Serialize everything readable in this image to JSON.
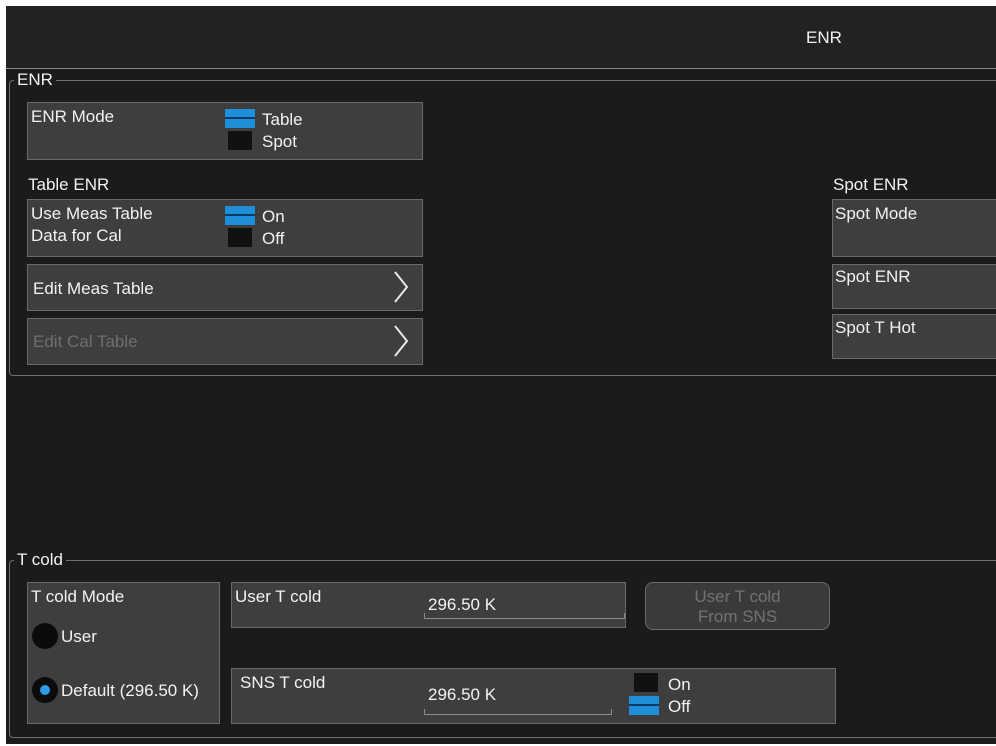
{
  "header": {
    "title": "ENR"
  },
  "enr_group": {
    "legend": "ENR",
    "enr_mode": {
      "label": "ENR Mode",
      "option_1": "Table",
      "option_2": "Spot",
      "selected": "Table"
    },
    "table_enr": {
      "heading": "Table ENR",
      "use_meas_label_1": "Use Meas Table",
      "use_meas_label_2": "Data for Cal",
      "option_on": "On",
      "option_off": "Off",
      "selected": "On",
      "edit_meas": "Edit Meas Table",
      "edit_cal": "Edit Cal Table"
    },
    "spot_enr": {
      "heading": "Spot ENR",
      "spot_mode": "Spot Mode",
      "spot_enr": "Spot ENR",
      "spot_t_hot": "Spot T Hot"
    }
  },
  "tcold_group": {
    "legend": "T cold",
    "mode": {
      "label": "T cold Mode",
      "option_user": "User",
      "option_default": "Default (296.50 K)",
      "selected": "Default (296.50 K)"
    },
    "user_tcold": {
      "label": "User T cold",
      "value": "296.50 K"
    },
    "from_sns": {
      "label_1": "User T cold",
      "label_2": "From SNS"
    },
    "sns_tcold": {
      "label": "SNS T cold",
      "value": "296.50 K",
      "option_on": "On",
      "option_off": "Off",
      "selected": "Off"
    }
  },
  "colors": {
    "background": "#1b1b1b",
    "control": "#3e3e3e",
    "accent": "#1e8fd8",
    "disabled_text": "#6f6f6f"
  },
  "icons": [
    "chevron-right-icon",
    "radio-icon",
    "toggle-indicator-icon"
  ]
}
